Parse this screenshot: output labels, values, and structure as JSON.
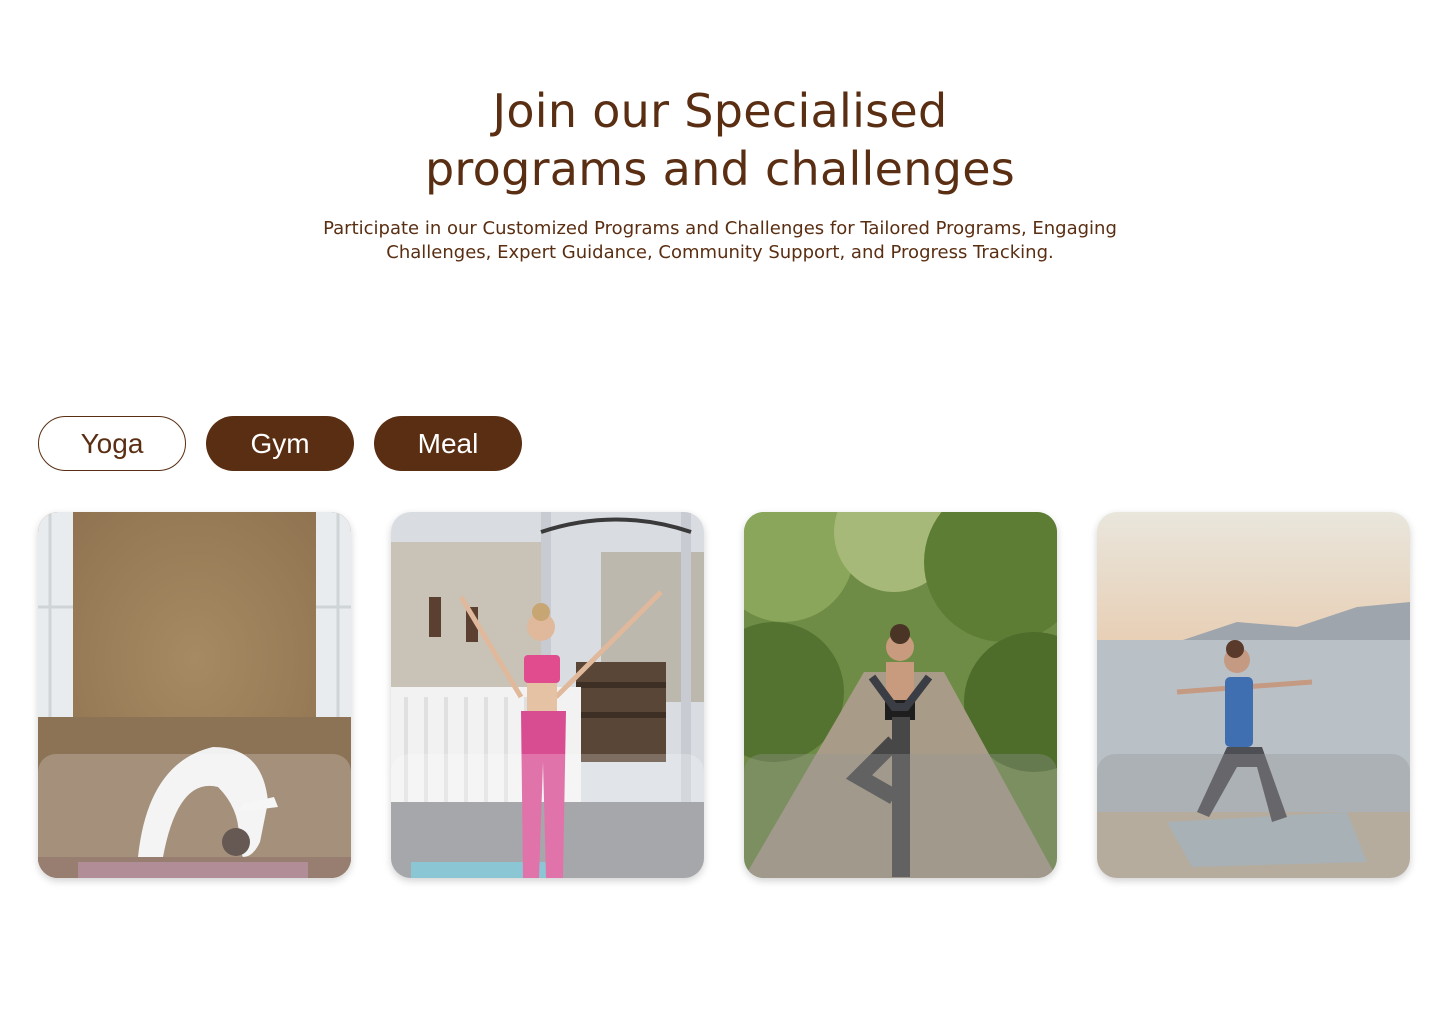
{
  "hero": {
    "title_line1": "Join our Specialised",
    "title_line2": "programs and challenges",
    "subtitle_line1": "Participate in our Customized Programs and Challenges for Tailored Programs, Engaging",
    "subtitle_line2": "Challenges, Expert Guidance, Community Support, and Progress Tracking."
  },
  "tabs": [
    {
      "label": "Yoga",
      "style": "outline"
    },
    {
      "label": "Gym",
      "style": "filled"
    },
    {
      "label": "Meal",
      "style": "filled"
    }
  ],
  "colors": {
    "brand_brown": "#5a2e12",
    "background": "#ffffff"
  },
  "cards": [
    {
      "image": "woman-in-backbend-yoga-pose-photo"
    },
    {
      "image": "woman-in-pink-activewear-arms-raised-photo"
    },
    {
      "image": "woman-in-tree-pose-on-forest-path-photo"
    },
    {
      "image": "woman-in-warrior-pose-on-beach-photo"
    }
  ]
}
